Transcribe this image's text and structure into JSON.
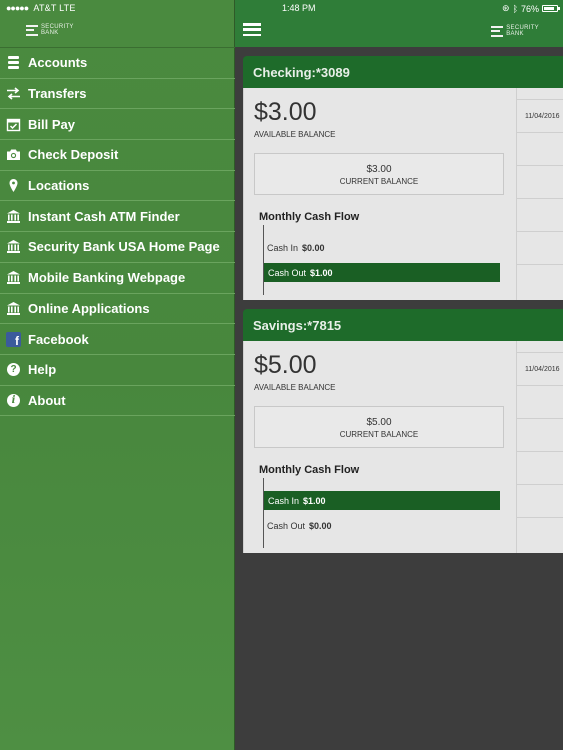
{
  "status": {
    "carrier": "AT&T",
    "network": "LTE",
    "time": "1:48 PM",
    "battery": "76%"
  },
  "logo": {
    "line1": "SECURITY",
    "line2": "BANK"
  },
  "menu": [
    {
      "label": "Accounts",
      "icon": "stack-icon"
    },
    {
      "label": "Transfers",
      "icon": "transfer-arrows-icon"
    },
    {
      "label": "Bill Pay",
      "icon": "calendar-check-icon"
    },
    {
      "label": "Check Deposit",
      "icon": "camera-icon"
    },
    {
      "label": "Locations",
      "icon": "map-pin-icon"
    },
    {
      "label": "Instant Cash ATM Finder",
      "icon": "bank-icon"
    },
    {
      "label": "Security Bank USA Home Page",
      "icon": "bank-icon"
    },
    {
      "label": "Mobile Banking Webpage",
      "icon": "bank-icon"
    },
    {
      "label": "Online Applications",
      "icon": "bank-icon"
    },
    {
      "label": "Facebook",
      "icon": "facebook-icon"
    },
    {
      "label": "Help",
      "icon": "help-icon"
    },
    {
      "label": "About",
      "icon": "info-icon"
    }
  ],
  "accounts": [
    {
      "title": "Checking:*3089",
      "available_balance": "$3.00",
      "available_label": "AVAILABLE BALANCE",
      "current_balance": "$3.00",
      "current_label": "CURRENT BALANCE",
      "cash_flow_title": "Monthly Cash Flow",
      "cash_in_label": "Cash In",
      "cash_in_value": "$0.00",
      "cash_out_label": "Cash Out",
      "cash_out_value": "$1.00",
      "txn_date": "11/04/2016"
    },
    {
      "title": "Savings:*7815",
      "available_balance": "$5.00",
      "available_label": "AVAILABLE BALANCE",
      "current_balance": "$5.00",
      "current_label": "CURRENT BALANCE",
      "cash_flow_title": "Monthly Cash Flow",
      "cash_in_label": "Cash In",
      "cash_in_value": "$1.00",
      "cash_out_label": "Cash Out",
      "cash_out_value": "$0.00",
      "txn_date": "11/04/2016"
    }
  ]
}
